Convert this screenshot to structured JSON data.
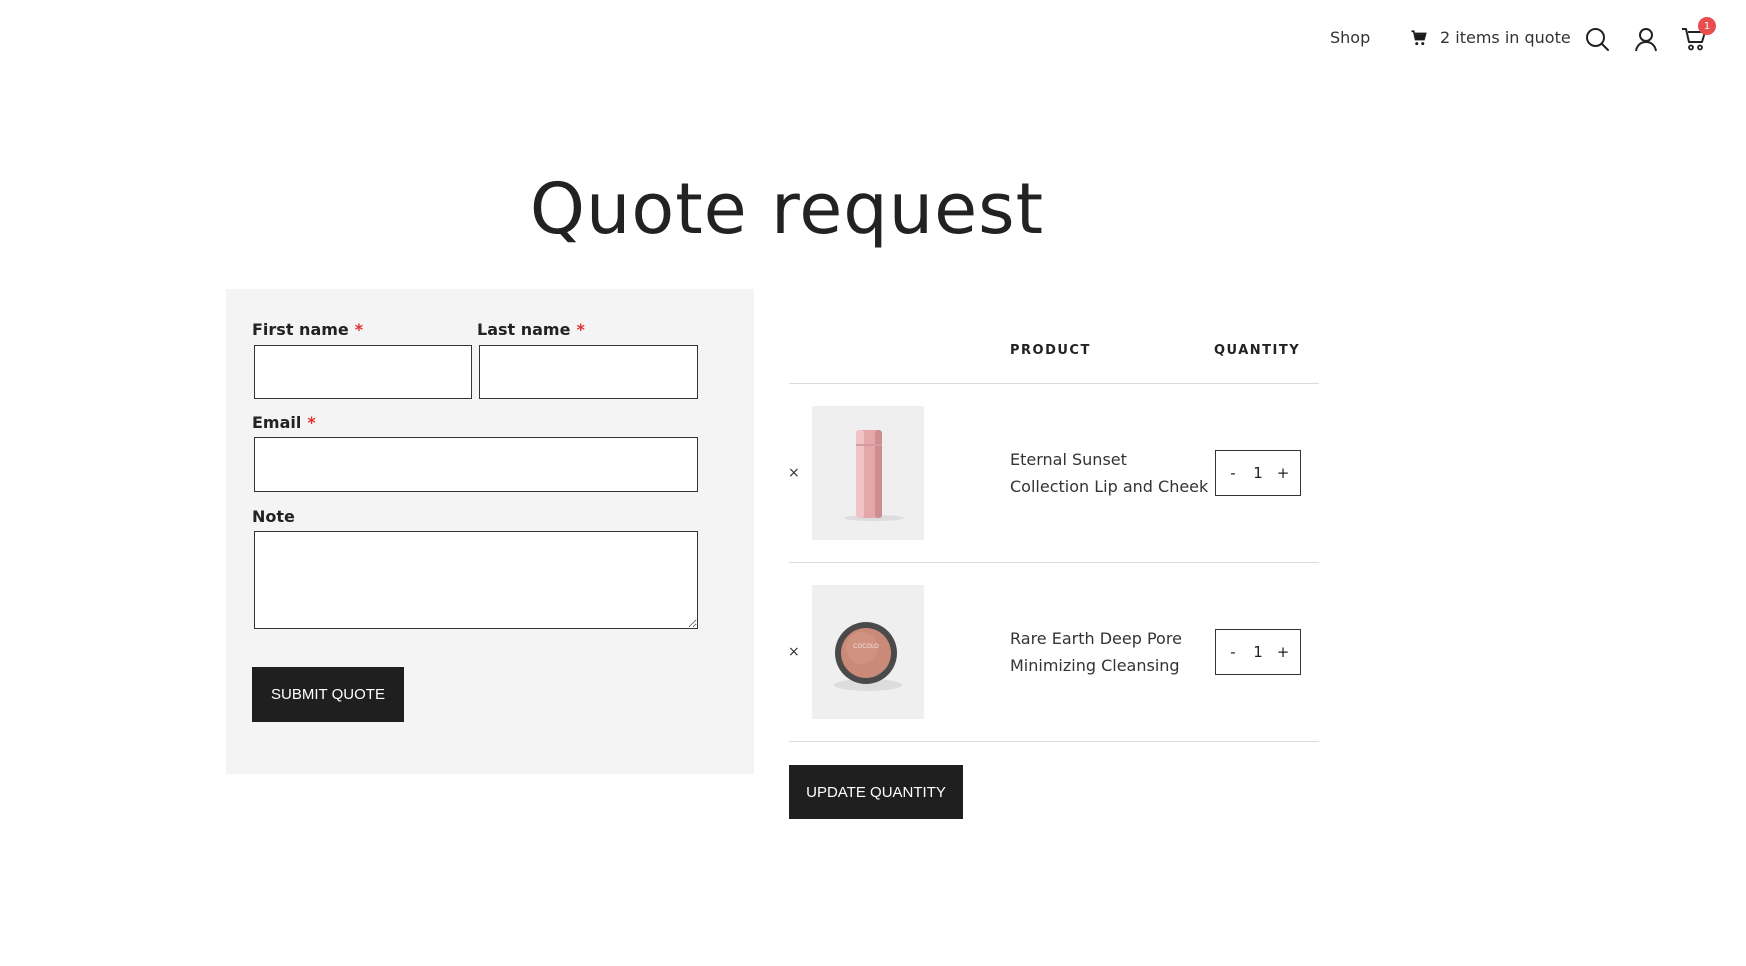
{
  "header": {
    "shop_label": "Shop",
    "quote_label": "2 items in quote",
    "cart_badge": "1",
    "icons": [
      "cart-small-icon",
      "search-icon",
      "user-icon",
      "cart-icon"
    ]
  },
  "page": {
    "title": "Quote request"
  },
  "form": {
    "first_name_label": "First name",
    "last_name_label": "Last name",
    "email_label": "Email",
    "note_label": "Note",
    "required_mark": "*",
    "first_name_value": "",
    "last_name_value": "",
    "email_value": "",
    "note_value": "",
    "submit_label": "SUBMIT QUOTE"
  },
  "table": {
    "headers": {
      "product": "PRODUCT",
      "quantity": "QUANTITY"
    },
    "remove_symbol": "×",
    "items": [
      {
        "line1": "Eternal Sunset",
        "line2": "Collection Lip and Cheek",
        "qty": "1"
      },
      {
        "line1": "Rare Earth Deep Pore",
        "line2": "Minimizing Cleansing",
        "qty": "1"
      }
    ],
    "qty_minus": "-",
    "qty_plus": "+",
    "jar_label": "COCOLO",
    "update_label": "UPDATE QUANTITY"
  },
  "colors": {
    "accent_dark": "#1f1f1f",
    "required": "#e32d2d",
    "badge": "#e94e4e",
    "panel_bg": "#f4f4f4"
  }
}
